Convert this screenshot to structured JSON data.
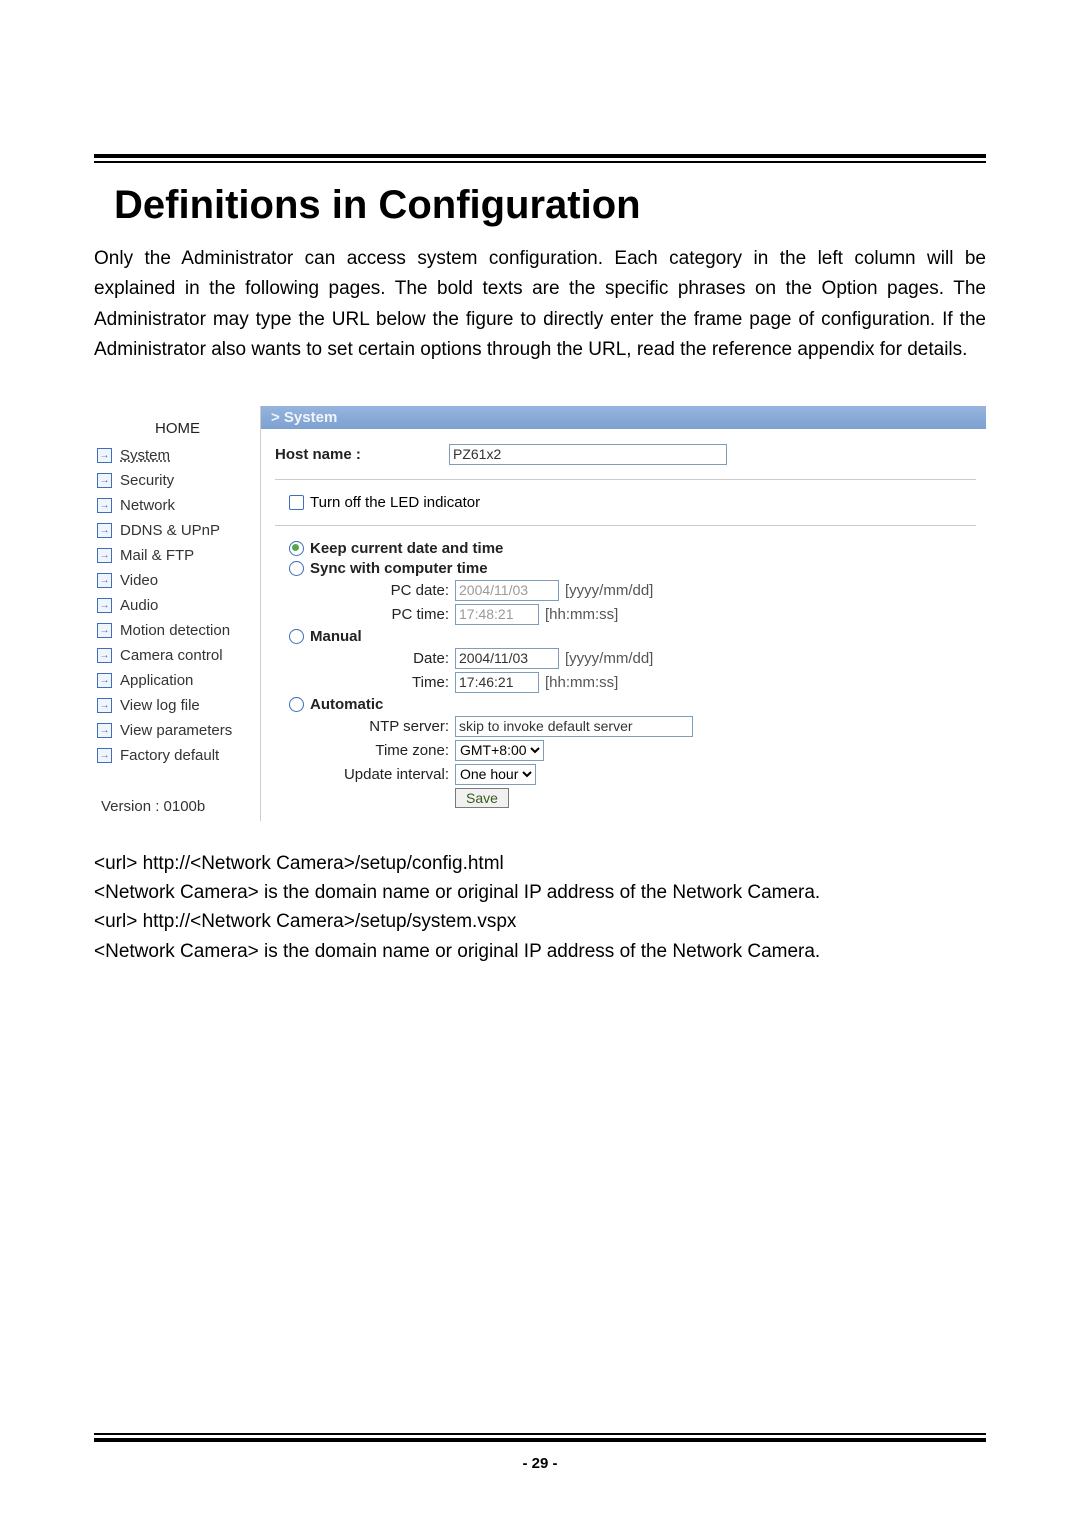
{
  "doc": {
    "title": "Definitions in Configuration",
    "intro": "Only the Administrator can access system configuration. Each category in the left column will be explained in the following pages. The bold texts are the specific phrases on the Option pages. The Administrator may type the URL below the figure to directly enter the frame page of configuration. If the Administrator also wants to set certain options through the URL, read the reference appendix for details.",
    "page_number": "- 29 -",
    "captions": [
      "<url> http://<Network Camera>/setup/config.html",
      "<Network Camera> is the domain name or original IP address of the Network Camera.",
      "<url> http://<Network Camera>/setup/system.vspx",
      "<Network Camera> is the domain name or original IP address of the Network Camera."
    ]
  },
  "ui": {
    "breadcrumb": "> System",
    "home": "HOME",
    "nav": [
      "System",
      "Security",
      "Network",
      "DDNS & UPnP",
      "Mail & FTP",
      "Video",
      "Audio",
      "Motion detection",
      "Camera control",
      "Application",
      "View log file",
      "View parameters",
      "Factory default"
    ],
    "version": "Version : 0100b",
    "hostname_label": "Host name :",
    "hostname_value": "PZ61x2",
    "led_label": "Turn off the LED indicator",
    "opt_keep": "Keep current date and time",
    "opt_sync": "Sync with computer time",
    "pc_date_label": "PC date:",
    "pc_date_value": "2004/11/03",
    "pc_date_hint": "[yyyy/mm/dd]",
    "pc_time_label": "PC time:",
    "pc_time_value": "17:48:21",
    "pc_time_hint": "[hh:mm:ss]",
    "opt_manual": "Manual",
    "m_date_label": "Date:",
    "m_date_value": "2004/11/03",
    "m_date_hint": "[yyyy/mm/dd]",
    "m_time_label": "Time:",
    "m_time_value": "17:46:21",
    "m_time_hint": "[hh:mm:ss]",
    "opt_auto": "Automatic",
    "ntp_label": "NTP server:",
    "ntp_value": "skip to invoke default server",
    "tz_label": "Time zone:",
    "tz_value": "GMT+8:00",
    "upd_label": "Update interval:",
    "upd_value": "One hour",
    "save": "Save"
  }
}
